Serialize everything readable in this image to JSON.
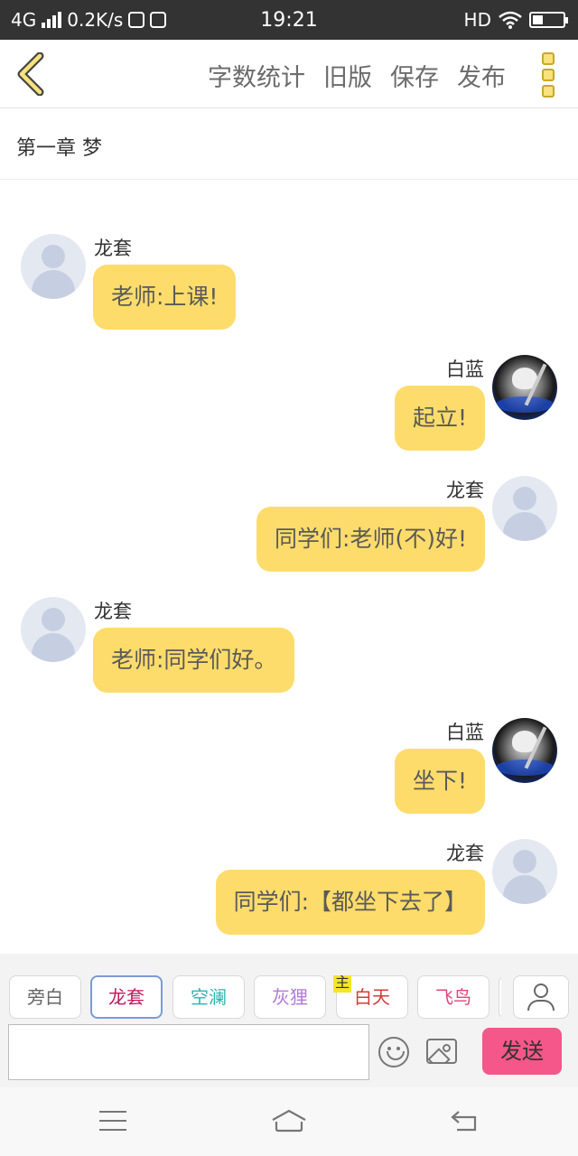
{
  "status_bar": {
    "network": "4G",
    "speed": "0.2K/s",
    "time": "19:21",
    "hd": "HD"
  },
  "toolbar": {
    "back_icon": "chevron-left-icon",
    "actions": [
      "字数统计",
      "旧版",
      "保存",
      "发布"
    ],
    "menu_icon": "more-vertical-icon"
  },
  "chapter_title": "第一章 梦",
  "messages": [
    {
      "side": "left",
      "name": "龙套",
      "text": "老师:上课!",
      "avatar": "default-avatar-icon"
    },
    {
      "side": "right",
      "name": "白蓝",
      "text": "起立!",
      "avatar": "anime-avatar"
    },
    {
      "side": "right",
      "name": "龙套",
      "text": "同学们:老师(不)好!",
      "avatar": "default-avatar-icon"
    },
    {
      "side": "left",
      "name": "龙套",
      "text": "老师:同学们好。",
      "avatar": "default-avatar-icon"
    },
    {
      "side": "right",
      "name": "白蓝",
      "text": "坐下!",
      "avatar": "anime-avatar"
    },
    {
      "side": "right",
      "name": "龙套",
      "text": "同学们:【都坐下去了】",
      "avatar": "default-avatar-icon"
    }
  ],
  "roles": [
    {
      "label": "旁白",
      "color": "#666666"
    },
    {
      "label": "龙套",
      "color": "#c2185b",
      "selected": true
    },
    {
      "label": "空澜",
      "color": "#26b6b0"
    },
    {
      "label": "灰狸",
      "color": "#b27ad9"
    },
    {
      "label": "白天",
      "color": "#d63a3a",
      "tag": "主"
    },
    {
      "label": "飞鸟",
      "color": "#e0457b"
    }
  ],
  "composer": {
    "input_value": "",
    "send_label": "发送"
  },
  "colors": {
    "bubble": "#fddc6b",
    "send_button": "#f5578a",
    "accent_icon": "#f7e27c"
  }
}
